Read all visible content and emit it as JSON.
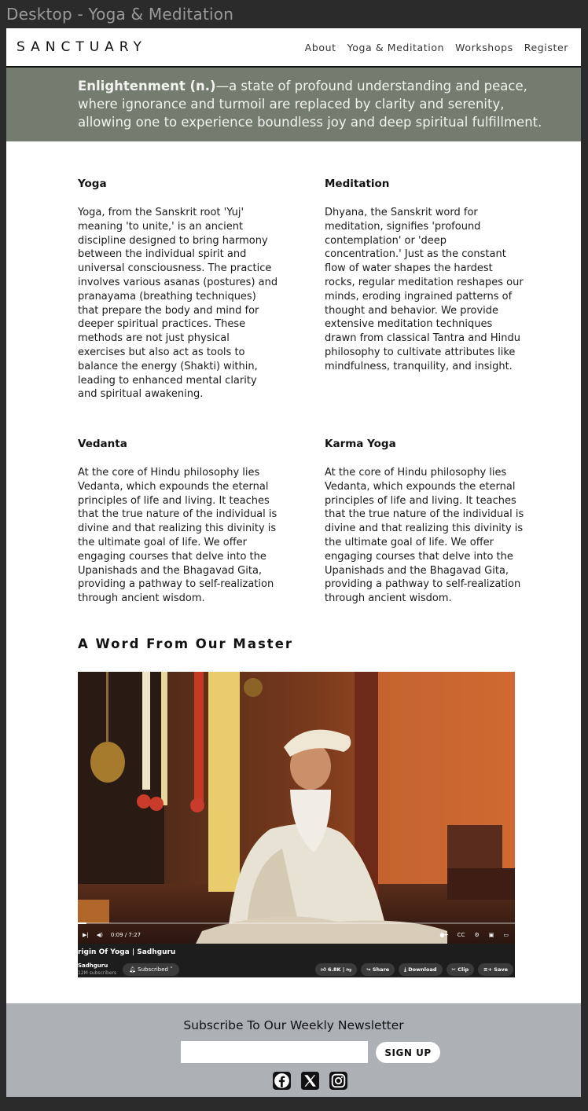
{
  "window_title": "Desktop - Yoga & Meditation",
  "brand": "SANCTUARY",
  "nav": {
    "items": [
      {
        "label": "About"
      },
      {
        "label": "Yoga & Meditation"
      },
      {
        "label": "Workshops"
      },
      {
        "label": "Register"
      }
    ]
  },
  "hero": {
    "term": "Enlightenment (n.)",
    "definition": "—a state of profound understanding and peace, where ignorance and turmoil are replaced by clarity and serenity, allowing one to experience boundless joy and deep spiritual fulfillment.",
    "background": "#737c6e"
  },
  "sections": [
    {
      "title": "Yoga",
      "body": "Yoga, from the Sanskrit root 'Yuj' meaning 'to unite,' is an ancient discipline designed to bring harmony between the individual spirit and universal consciousness. The practice involves various asanas (postures) and pranayama (breathing techniques) that prepare the body and mind for deeper spiritual practices. These methods are not just physical exercises but also act as tools to balance the energy (Shakti) within, leading to enhanced mental clarity and spiritual awakening."
    },
    {
      "title": "Meditation",
      "body": "Dhyana, the Sanskrit word for meditation, signifies 'profound contemplation' or 'deep concentration.' Just as the constant flow of water shapes the hardest rocks, regular meditation reshapes our minds, eroding ingrained patterns of thought and behavior. We provide extensive meditation techniques drawn from classical Tantra and Hindu philosophy to cultivate attributes like mindfulness, tranquility, and insight."
    },
    {
      "title": "Vedanta",
      "body": "At the core of Hindu philosophy lies Vedanta, which expounds the eternal principles of life and living. It teaches that the true nature of the individual is divine and that realizing this divinity is the ultimate goal of life. We offer engaging courses that delve into the Upanishads and the Bhagavad Gita, providing a pathway to self-realization through ancient wisdom."
    },
    {
      "title": "Karma Yoga",
      "body": "At the core of Hindu philosophy lies Vedanta, which expounds the eternal principles of life and living. It teaches that the true nature of the individual is divine and that realizing this divinity is the ultimate goal of life. We offer engaging courses that delve into the Upanishads and the Bhagavad Gita, providing a pathway to self-realization through ancient wisdom."
    }
  ],
  "word_section_title": "A Word From Our Master",
  "video": {
    "time": "0:09 / 7:27",
    "progress": 0.02,
    "title": "rigin Of Yoga | Sadhguru",
    "channel": "Sadhguru",
    "subscribers": "12M subscribers",
    "subscribed_label": "Subscribed",
    "likes": "6.8K",
    "actions": [
      "Share",
      "Download",
      "Clip",
      "Save"
    ]
  },
  "newsletter": {
    "title": "Subscribe To Our Weekly Newsletter",
    "input_value": "",
    "button_label": "SIGN UP",
    "background": "#adb1b5"
  },
  "socials": [
    "facebook-icon",
    "x-icon",
    "instagram-icon"
  ]
}
